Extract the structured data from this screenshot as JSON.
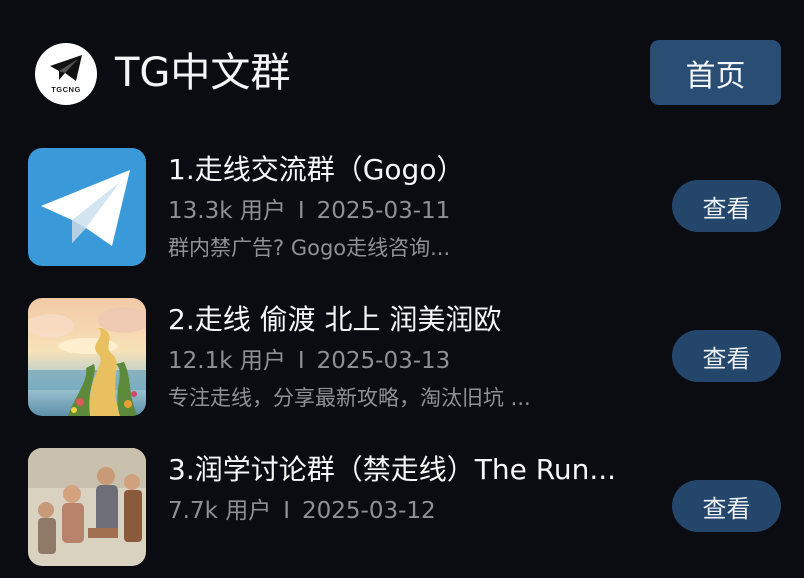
{
  "header": {
    "logo_text": "TGCNG",
    "title": "TG中文群",
    "home_label": "首页"
  },
  "groups": [
    {
      "title": "1.走线交流群（Gogo）",
      "users": "13.3k 用户",
      "separator": "I",
      "date": "2025-03-11",
      "desc": "群内禁广告? Gogo走线咨询...",
      "view_label": "查看",
      "icon": "telegram-icon"
    },
    {
      "title": "2.走线 偷渡 北上 润美润欧",
      "users": "12.1k 用户",
      "separator": "I",
      "date": "2025-03-13",
      "desc": "专注走线，分享最新攻略，淘汰旧坑 ...",
      "view_label": "查看",
      "icon": "painted-path-image"
    },
    {
      "title": "3.润学讨论群（禁走线）The Run...",
      "users": "7.7k 用户",
      "separator": "I",
      "date": "2025-03-12",
      "desc": "",
      "view_label": "查看",
      "icon": "painted-figures-image"
    }
  ],
  "colors": {
    "background": "#0b0b12",
    "button": "#2a4d73",
    "telegram_blue": "#3a9ad9",
    "muted_text": "#8f8f96"
  }
}
